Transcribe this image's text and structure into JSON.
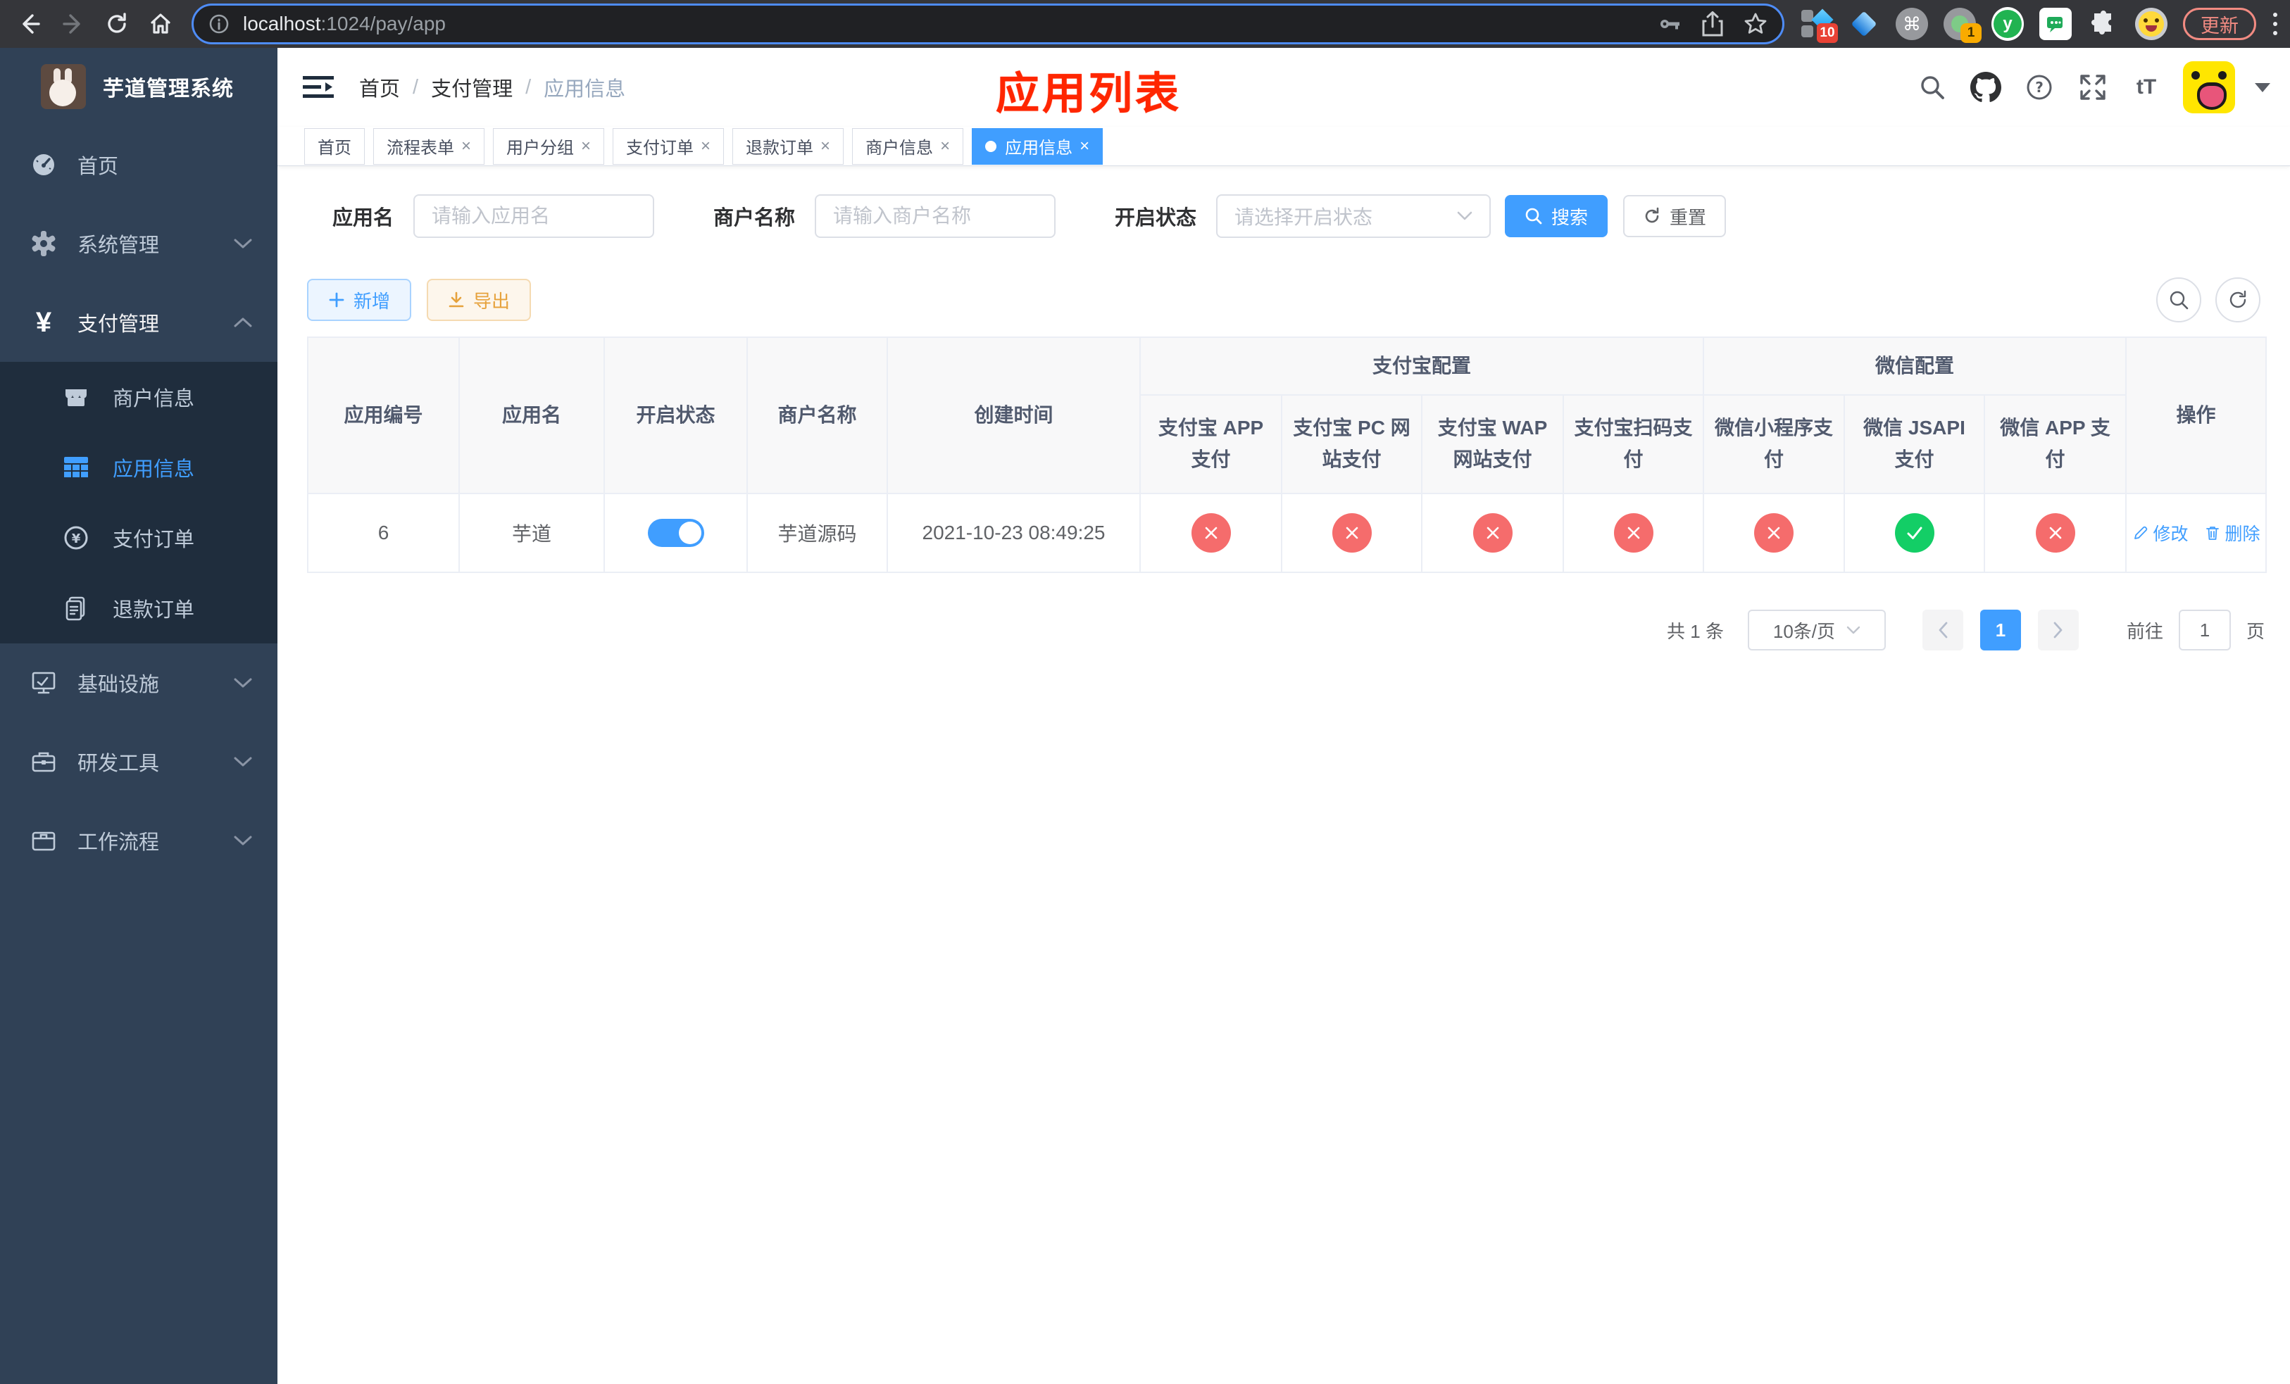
{
  "browser": {
    "url_host": "localhost",
    "url_path": ":1024/pay/app",
    "update_label": "更新",
    "ext_badge_1": "10",
    "ext_badge_2": "1",
    "ext_y_logo": "y"
  },
  "glyphs": {
    "yen": "¥",
    "command": "⌘",
    "font_size": "tT",
    "close": "×",
    "separator": "/",
    "question": "?"
  },
  "sidebar": {
    "title": "芋道管理系统",
    "items": [
      {
        "label": "首页"
      },
      {
        "label": "系统管理"
      },
      {
        "label": "支付管理"
      },
      {
        "label": "商户信息"
      },
      {
        "label": "应用信息"
      },
      {
        "label": "支付订单"
      },
      {
        "label": "退款订单"
      },
      {
        "label": "基础设施"
      },
      {
        "label": "研发工具"
      },
      {
        "label": "工作流程"
      }
    ]
  },
  "header": {
    "breadcrumb": [
      "首页",
      "支付管理",
      "应用信息"
    ],
    "annotation": "应用列表"
  },
  "tabs": [
    {
      "label": "首页",
      "closable": false,
      "active": false
    },
    {
      "label": "流程表单",
      "closable": true,
      "active": false
    },
    {
      "label": "用户分组",
      "closable": true,
      "active": false
    },
    {
      "label": "支付订单",
      "closable": true,
      "active": false
    },
    {
      "label": "退款订单",
      "closable": true,
      "active": false
    },
    {
      "label": "商户信息",
      "closable": true,
      "active": false
    },
    {
      "label": "应用信息",
      "closable": true,
      "active": true
    }
  ],
  "filters": {
    "app_name_label": "应用名",
    "app_name_placeholder": "请输入应用名",
    "merchant_label": "商户名称",
    "merchant_placeholder": "请输入商户名称",
    "status_label": "开启状态",
    "status_placeholder": "请选择开启状态",
    "search_label": "搜索",
    "reset_label": "重置"
  },
  "toolbar": {
    "add_label": "新增",
    "export_label": "导出"
  },
  "table": {
    "columns": [
      "应用编号",
      "应用名",
      "开启状态",
      "商户名称",
      "创建时间"
    ],
    "groups": {
      "alipay": "支付宝配置",
      "wechat": "微信配置"
    },
    "alipay_cols": [
      "支付宝 APP 支付",
      "支付宝 PC 网站支付",
      "支付宝 WAP 网站支付",
      "支付宝扫码支付"
    ],
    "wechat_cols": [
      "微信小程序支付",
      "微信 JSAPI 支付",
      "微信 APP 支付"
    ],
    "op_label": "操作",
    "row": {
      "id": "6",
      "name": "芋道",
      "enabled": true,
      "merchant": "芋道源码",
      "created": "2021-10-23 08:49:25",
      "channels": [
        false,
        false,
        false,
        false,
        false,
        true,
        false
      ],
      "actions": {
        "edit": "修改",
        "delete": "删除"
      }
    }
  },
  "pagination": {
    "total": "共 1 条",
    "page_size": "10条/页",
    "current_page": "1",
    "goto_label": "前往",
    "goto_value": "1",
    "page_unit": "页"
  },
  "colors": {
    "accent": "#409eff",
    "danger": "#f56c6c",
    "success": "#13ce66",
    "warning": "#e6a23c",
    "sidebar_bg": "#304156",
    "submenu_bg": "#1f2d3d"
  }
}
